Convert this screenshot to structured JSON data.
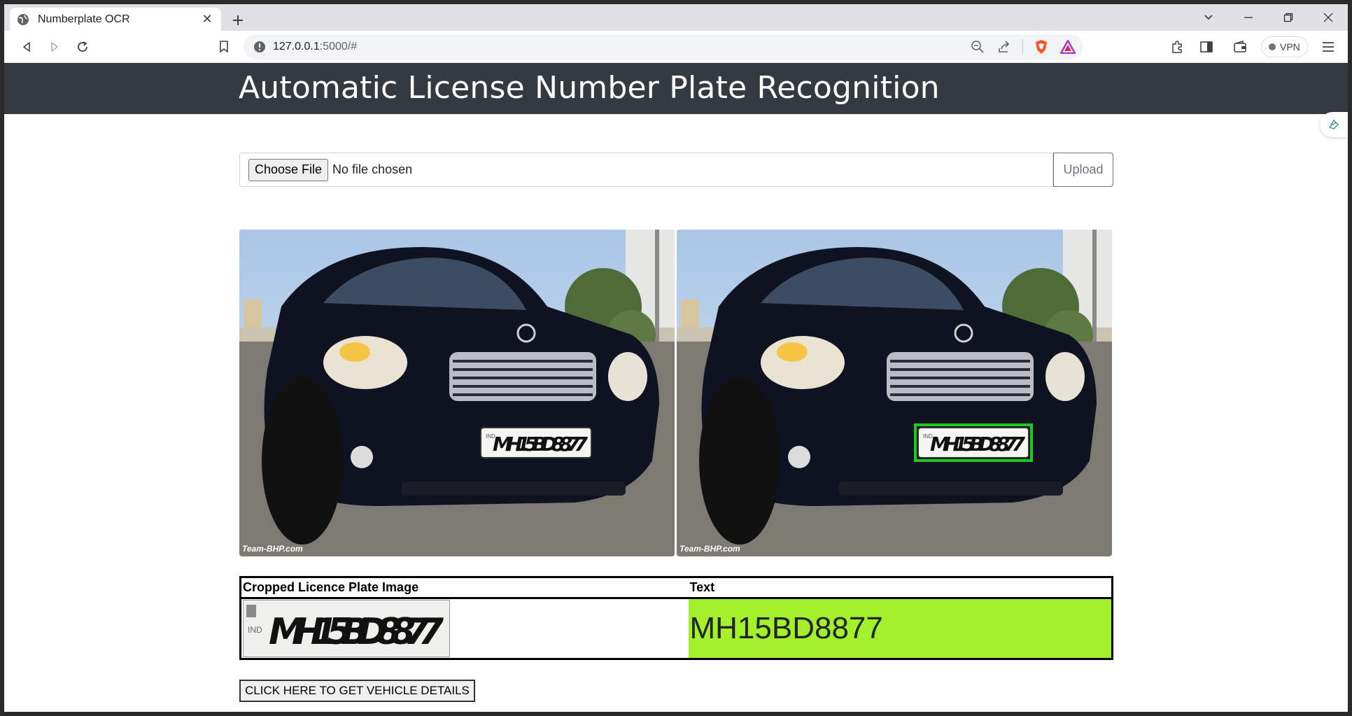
{
  "browser": {
    "tab_title": "Numberplate OCR",
    "url_host": "127.0.0.1",
    "url_rest": ":5000/#",
    "vpn_label": "VPN"
  },
  "page": {
    "title": "Automatic License Number Plate Recognition",
    "choose_file_label": "Choose File",
    "file_status": "No file chosen",
    "upload_label": "Upload",
    "table": {
      "col_image": "Cropped Licence Plate Image",
      "col_text": "Text",
      "plate_text": "MH15BD8877"
    },
    "details_button": "CLICK HERE TO GET VEHICLE DETAILS",
    "image_plate": "MH15BD8877",
    "image_plate_country": "IND",
    "image_watermark": "Team-BHP.com"
  },
  "colors": {
    "navbar": "#343a40",
    "text_cell_bg": "#a4f02c",
    "detection_box": "#1ec81e"
  }
}
